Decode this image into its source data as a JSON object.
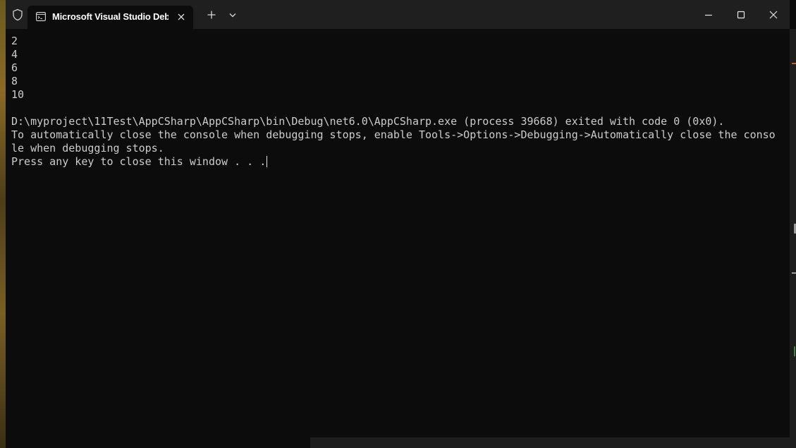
{
  "window": {
    "tab_title": "Microsoft Visual Studio Debug Console",
    "colors": {
      "titlebar": "#1f1f1f",
      "console_bg": "#0c0c0c",
      "console_text": "#cccccc"
    }
  },
  "titlebar": {
    "icons": {
      "shield": "shield-icon",
      "tab": "terminal-icon",
      "tab_close": "close-icon",
      "new_tab": "plus-icon",
      "dropdown": "chevron-down-icon",
      "minimize": "minimize-icon",
      "maximize": "maximize-icon",
      "close": "close-icon"
    }
  },
  "console": {
    "lines": [
      "2",
      "4",
      "6",
      "8",
      "10",
      "",
      "D:\\myproject\\11Test\\AppCSharp\\AppCSharp\\bin\\Debug\\net6.0\\AppCSharp.exe (process 39668) exited with code 0 (0x0).",
      "To automatically close the console when debugging stops, enable Tools->Options->Debugging->Automatically close the conso",
      "le when debugging stops.",
      "Press any key to close this window . . ."
    ]
  }
}
